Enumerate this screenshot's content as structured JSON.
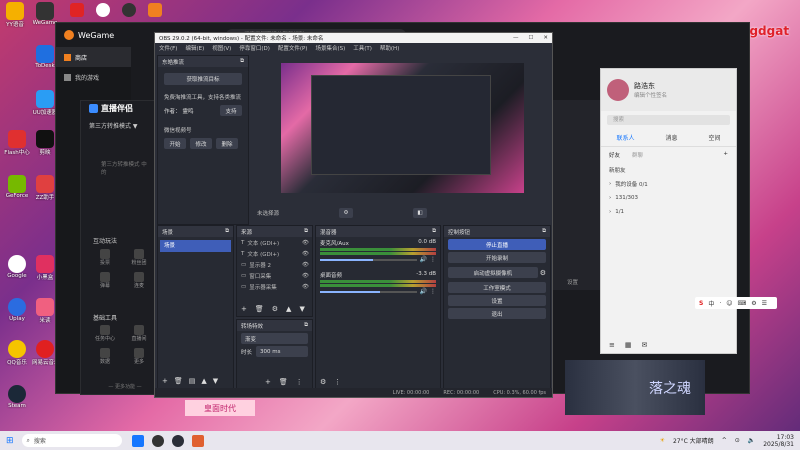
{
  "desktop": {
    "watermark": "vx:wgdgat",
    "icons": [
      "YY语音",
      "WeGame",
      "ToDesk",
      "UU加速器",
      "Flash中心",
      "剪映",
      "GeForce",
      "ZZ助手",
      "Google",
      "小黑盒",
      "Uplay",
      "Steam",
      "QQ音乐",
      "网易云音乐",
      "米读"
    ],
    "banner_text": "落之魂",
    "banner2_text": "皇面时代"
  },
  "wegame": {
    "title": "WeGame",
    "search_placeholder": "搜索王国期待抽取新福利",
    "nav": [
      "商店",
      "我的游戏"
    ]
  },
  "live": {
    "title": "直播伴侣",
    "mode": "第三方转推模式 ▼",
    "mode_desc": "第三方转推模式 中的",
    "interaction": "互动玩法",
    "basic_tools": "基础工具",
    "more": "— 更多功能 —",
    "ico_labels": [
      "投票",
      "粉丝团",
      "弹幕",
      "连麦",
      "任务中心",
      "直播间",
      "数据",
      "更多"
    ]
  },
  "obs": {
    "title": "OBS 29.0.2 (64-bit, windows) - 配置文件: 未命名 - 场景: 未命名",
    "menu": [
      "文件(F)",
      "编辑(E)",
      "视图(V)",
      "停靠窗口(D)",
      "配置文件(P)",
      "场景集合(S)",
      "工具(T)",
      "帮助(H)"
    ],
    "stream_dock": {
      "title": "东皓推流",
      "btn_get": "获取推流目标",
      "notice": "免费淘推流工具，支持各类推流",
      "author_label": "作者：",
      "author": "霊鸣",
      "support": "支持",
      "wechat": "微信视频号",
      "btns": [
        "开始",
        "修改",
        "删除"
      ]
    },
    "scene_status": "未选择源",
    "docks": {
      "scenes": {
        "title": "场景",
        "items": [
          "场景"
        ]
      },
      "sources": {
        "title": "来源",
        "items": [
          "文本 (GDI+)",
          "文本 (GDI+)",
          "显示器 2",
          "窗口采集",
          "显示器采集"
        ]
      },
      "mixer": {
        "title": "混音器",
        "channels": [
          {
            "name": "麦克风/Aux",
            "db": "0.0 dB",
            "level": 0.55
          },
          {
            "name": "桌面音频",
            "db": "-3.3 dB",
            "level": 0.62
          }
        ]
      },
      "transitions": {
        "title": "转场特效",
        "type": "渐变",
        "duration_label": "时长",
        "duration": "300 ms"
      },
      "controls": {
        "title": "控制按钮",
        "btns": [
          "停止直播",
          "开始录制",
          "启动虚拟摄像机",
          "工作室模式",
          "设置",
          "退出"
        ]
      }
    },
    "statusbar": {
      "live": "LIVE: 00:00:00",
      "rec": "REC: 00:00:00",
      "cpu": "CPU: 0.3%, 60.00 fps"
    }
  },
  "qq": {
    "name": "路浩东",
    "signature": "编辑个性签名",
    "search": "搜索",
    "tabs": [
      "联系人",
      "消息",
      "空间"
    ],
    "subtabs": [
      "好友",
      "群聊"
    ],
    "groups": [
      "新朋友",
      "我的设备 0/1",
      "131/303",
      "1/1"
    ]
  },
  "bg_window": {
    "label1": "设置",
    "label2": "设置"
  },
  "taskbar": {
    "search": "搜索",
    "weather": "27°C 大部晴朗",
    "time": "17:03",
    "date": "2025/8/31",
    "ime": [
      "中",
      "·",
      "☺",
      "⌨",
      "⚙",
      "☰"
    ]
  }
}
